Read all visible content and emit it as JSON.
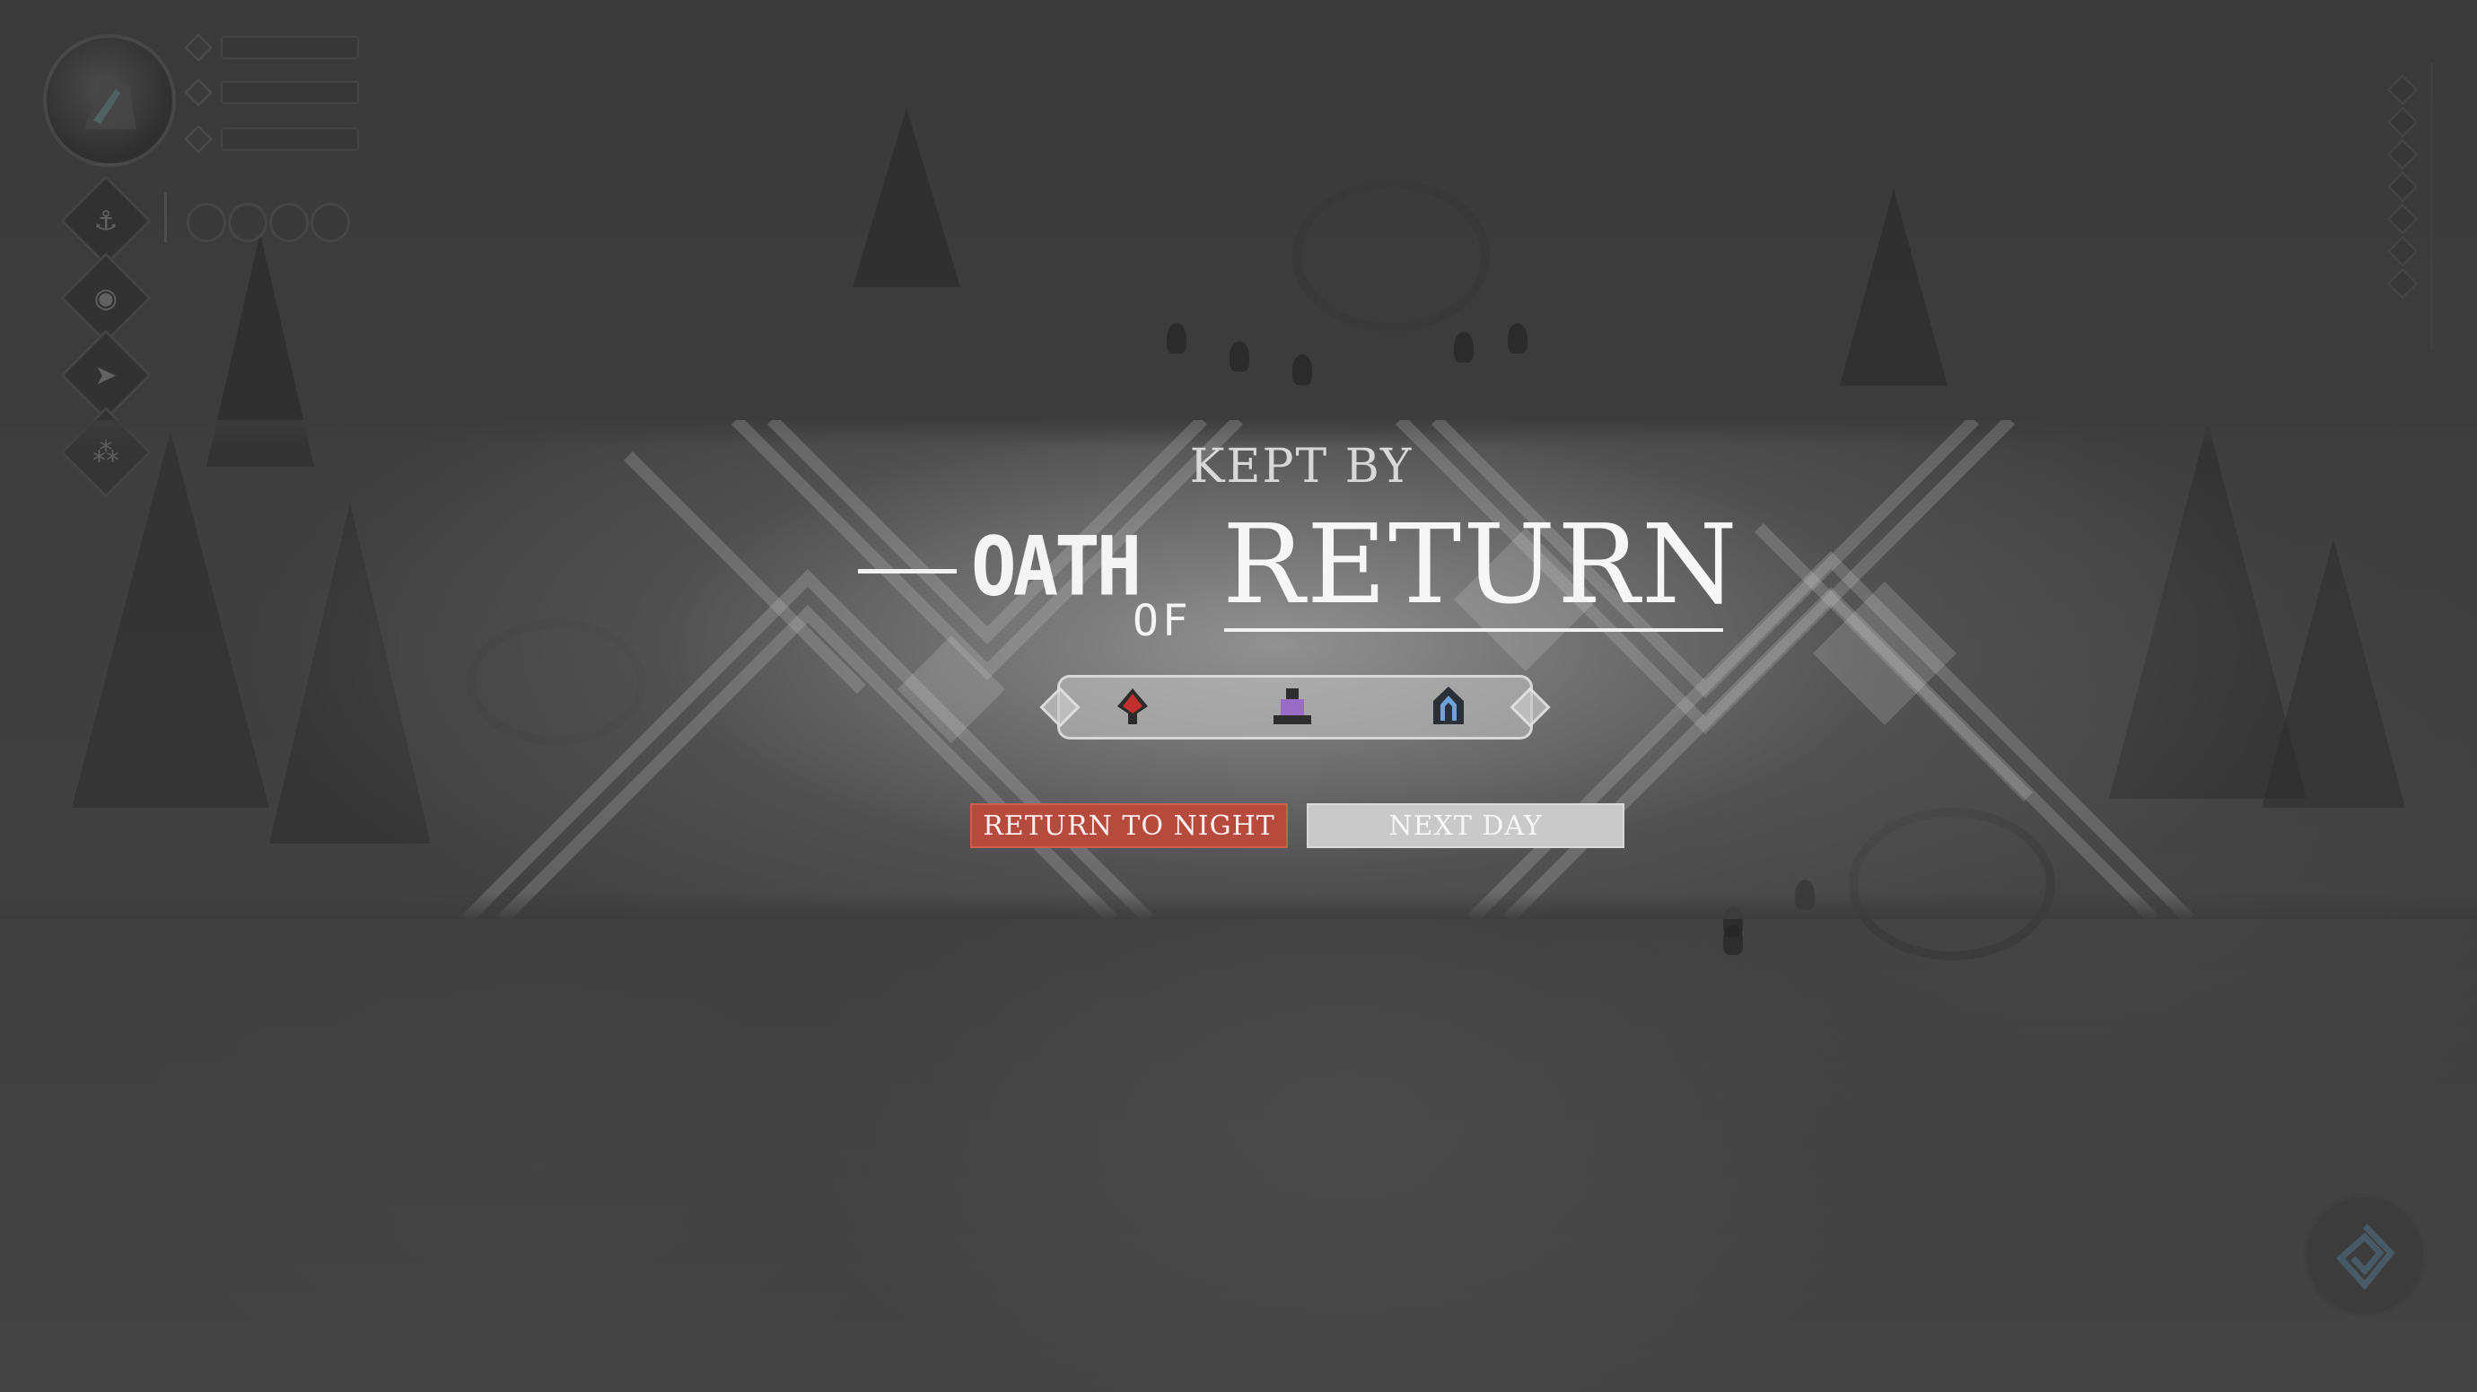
{
  "banner": {
    "kept_by": "KEPT BY",
    "title_oath": "OATH",
    "title_of": "OF",
    "title_return": "RETURN"
  },
  "emblems": [
    {
      "icon": "red-spade-icon",
      "color": "#c23030"
    },
    {
      "icon": "purple-hat-icon",
      "color": "#9a6cc8"
    },
    {
      "icon": "blue-arch-icon",
      "color": "#6fa2d8"
    }
  ],
  "buttons": {
    "return_to_night": "RETURN TO NIGHT",
    "next_day": "NEXT DAY"
  },
  "colors": {
    "accent_red": "#b64a3c",
    "neutral_button": "#c9c9c9",
    "title_white": "#f4f4f4"
  },
  "hud": {
    "ability_icons": [
      "anchor-icon",
      "eye-icon",
      "dash-icon",
      "cluster-icon"
    ],
    "stat_icons": [
      "diamond-icon",
      "diamond-icon",
      "flask-icon"
    ]
  }
}
